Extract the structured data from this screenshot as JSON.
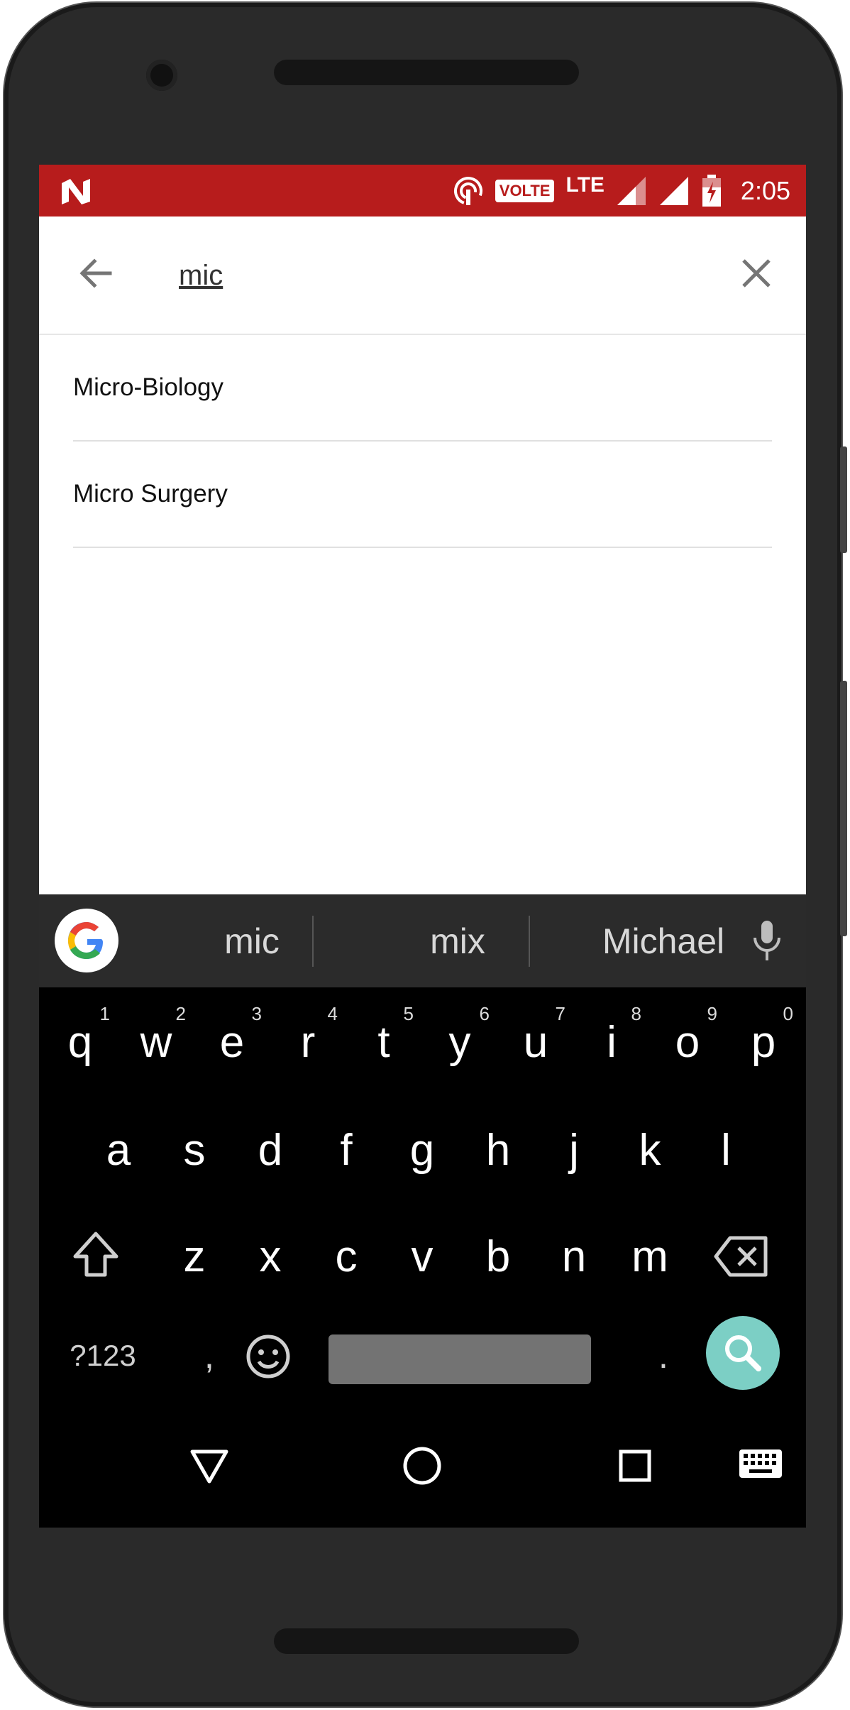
{
  "status_bar": {
    "volte": "VOLTE",
    "network": "LTE",
    "time": "2:05"
  },
  "search": {
    "query": "mic"
  },
  "results": [
    {
      "label": "Micro-Biology"
    },
    {
      "label": "Micro Surgery"
    }
  ],
  "keyboard": {
    "suggestions": [
      "mic",
      "mix",
      "Michael"
    ],
    "row1": [
      "q",
      "w",
      "e",
      "r",
      "t",
      "y",
      "u",
      "i",
      "o",
      "p"
    ],
    "row1_hints": [
      "1",
      "2",
      "3",
      "4",
      "5",
      "6",
      "7",
      "8",
      "9",
      "0"
    ],
    "row2": [
      "a",
      "s",
      "d",
      "f",
      "g",
      "h",
      "j",
      "k",
      "l"
    ],
    "row3": [
      "z",
      "x",
      "c",
      "v",
      "b",
      "n",
      "m"
    ],
    "symbols_key": "?123",
    "comma_key": ",",
    "period_key": "."
  },
  "colors": {
    "status_bar": "#b71c1c",
    "search_key": "#7ccfc5",
    "keyboard_bg": "#000000",
    "suggestion_bg": "#2b2b2b"
  },
  "icons": {
    "back": "arrow-left-icon",
    "clear": "close-icon",
    "google": "google-g-icon",
    "mic": "microphone-icon",
    "shift": "shift-icon",
    "backspace": "backspace-icon",
    "emoji": "emoji-icon",
    "search": "search-icon",
    "nav_back": "triangle-back-icon",
    "nav_home": "circle-home-icon",
    "nav_recents": "square-recents-icon",
    "nav_keyboard": "keyboard-icon"
  }
}
